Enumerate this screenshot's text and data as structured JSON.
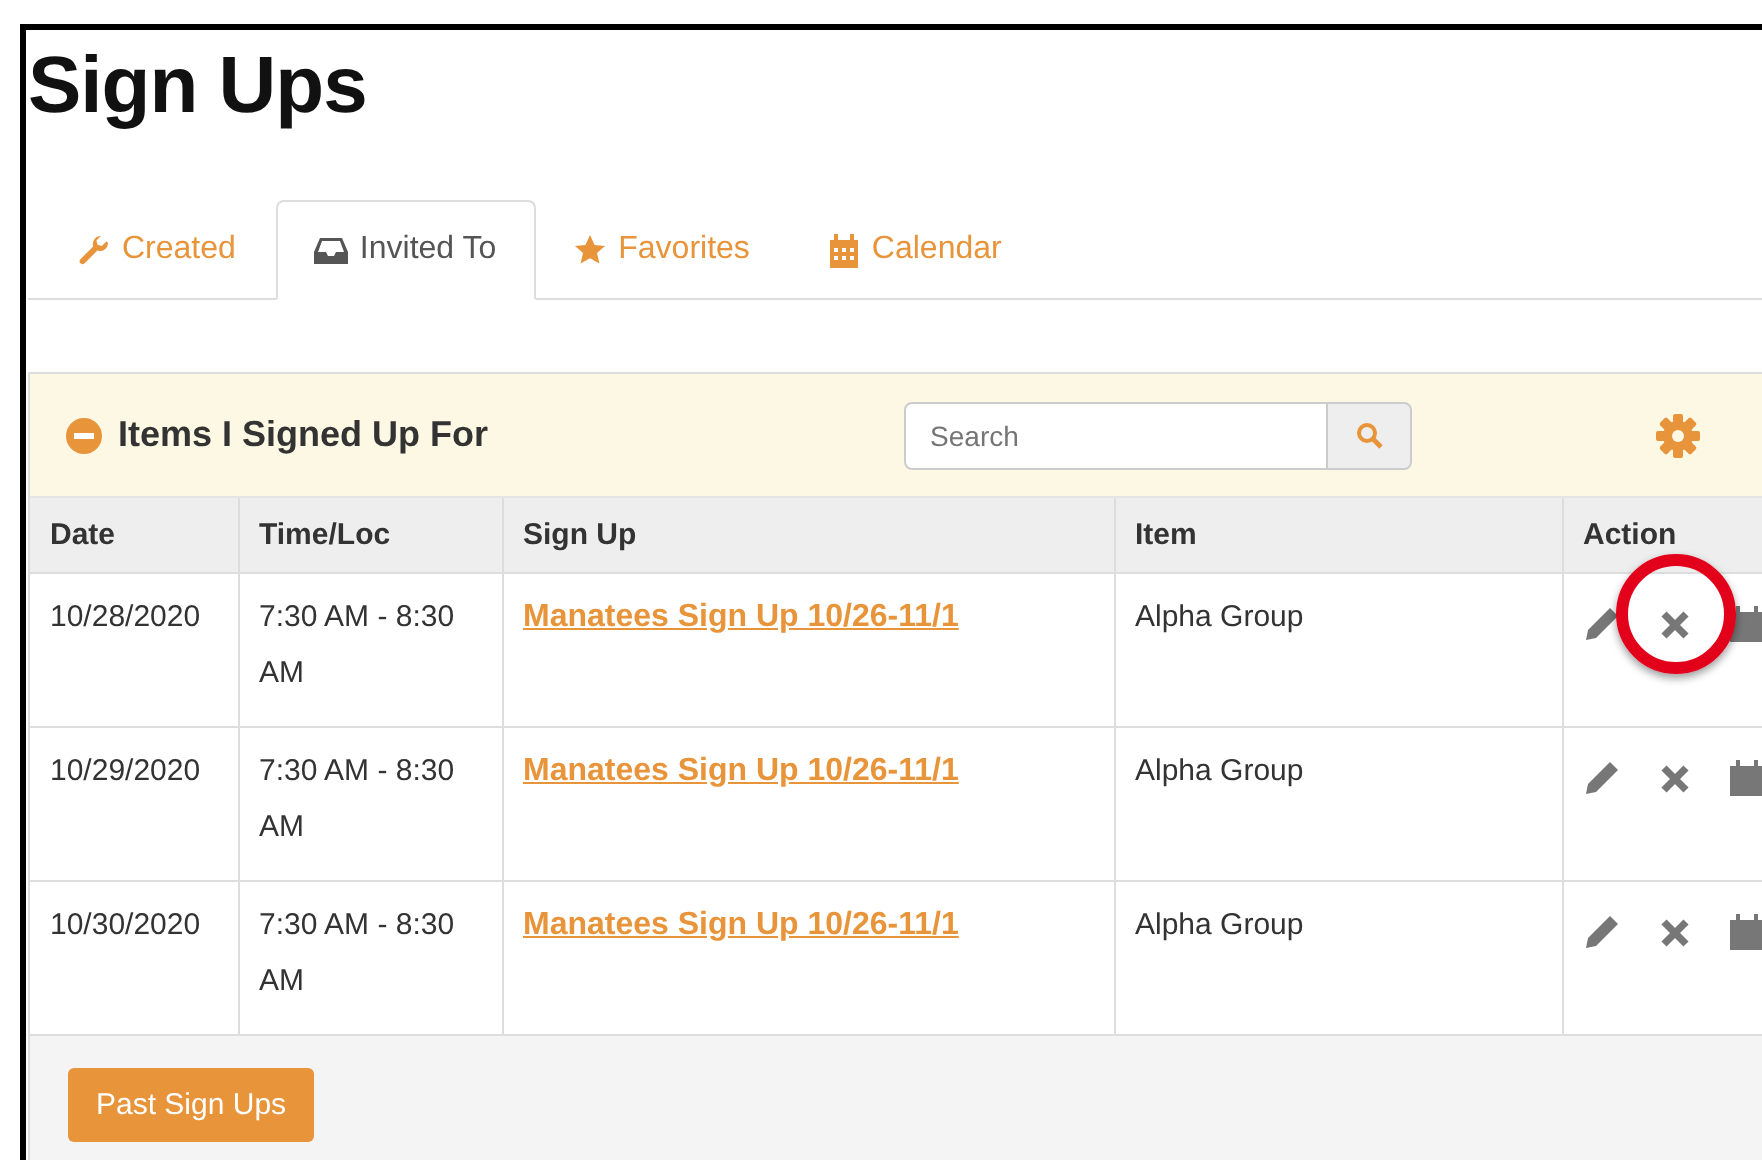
{
  "title": "Sign Ups",
  "tabs": [
    {
      "label": "Created",
      "kind": "wrench",
      "selected": false
    },
    {
      "label": "Invited To",
      "kind": "inbox",
      "selected": true
    },
    {
      "label": "Favorites",
      "kind": "star",
      "selected": false
    },
    {
      "label": "Calendar",
      "kind": "calendar",
      "selected": false
    }
  ],
  "panel": {
    "title": "Items I Signed Up For",
    "search": {
      "placeholder": "Search"
    }
  },
  "table": {
    "columns": [
      "Date",
      "Time/Loc",
      "Sign Up",
      "Item",
      "Action"
    ],
    "rows": [
      {
        "date": "10/28/2020",
        "time": "7:30 AM - 8:30 AM",
        "signup": "Manatees Sign Up 10/26-11/1",
        "item": "Alpha Group",
        "delete_circled": true
      },
      {
        "date": "10/29/2020",
        "time": "7:30 AM - 8:30 AM",
        "signup": "Manatees Sign Up 10/26-11/1",
        "item": "Alpha Group",
        "delete_circled": false
      },
      {
        "date": "10/30/2020",
        "time": "7:30 AM - 8:30 AM",
        "signup": "Manatees Sign Up 10/26-11/1",
        "item": "Alpha Group",
        "delete_circled": false
      }
    ]
  },
  "footer_button": "Past Sign Ups"
}
